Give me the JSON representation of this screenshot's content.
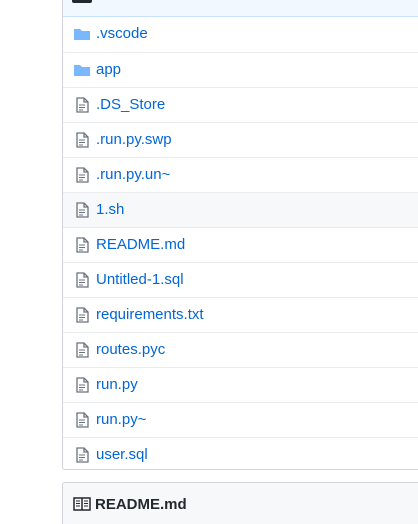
{
  "files": [
    {
      "name": ".vscode",
      "type": "folder",
      "icon": "folder-icon"
    },
    {
      "name": "app",
      "type": "folder",
      "icon": "folder-icon"
    },
    {
      "name": ".DS_Store",
      "type": "file",
      "icon": "file-icon"
    },
    {
      "name": ".run.py.swp",
      "type": "file",
      "icon": "file-icon"
    },
    {
      "name": ".run.py.un~",
      "type": "file",
      "icon": "file-icon"
    },
    {
      "name": "1.sh",
      "type": "file",
      "icon": "file-icon",
      "hovered": true
    },
    {
      "name": "README.md",
      "type": "file",
      "icon": "file-icon"
    },
    {
      "name": "Untitled-1.sql",
      "type": "file",
      "icon": "file-icon"
    },
    {
      "name": "requirements.txt",
      "type": "file",
      "icon": "file-icon"
    },
    {
      "name": "routes.pyc",
      "type": "file",
      "icon": "file-icon"
    },
    {
      "name": "run.py",
      "type": "file",
      "icon": "file-icon"
    },
    {
      "name": "run.py~",
      "type": "file",
      "icon": "file-icon"
    },
    {
      "name": "user.sql",
      "type": "file",
      "icon": "file-icon"
    }
  ],
  "readme": {
    "title": "README.md",
    "icon": "book-icon"
  },
  "colors": {
    "link": "#0366d6",
    "folder": "#79b8ff",
    "file_icon": "#6a737d",
    "hover_bg": "#f6f8fa"
  }
}
